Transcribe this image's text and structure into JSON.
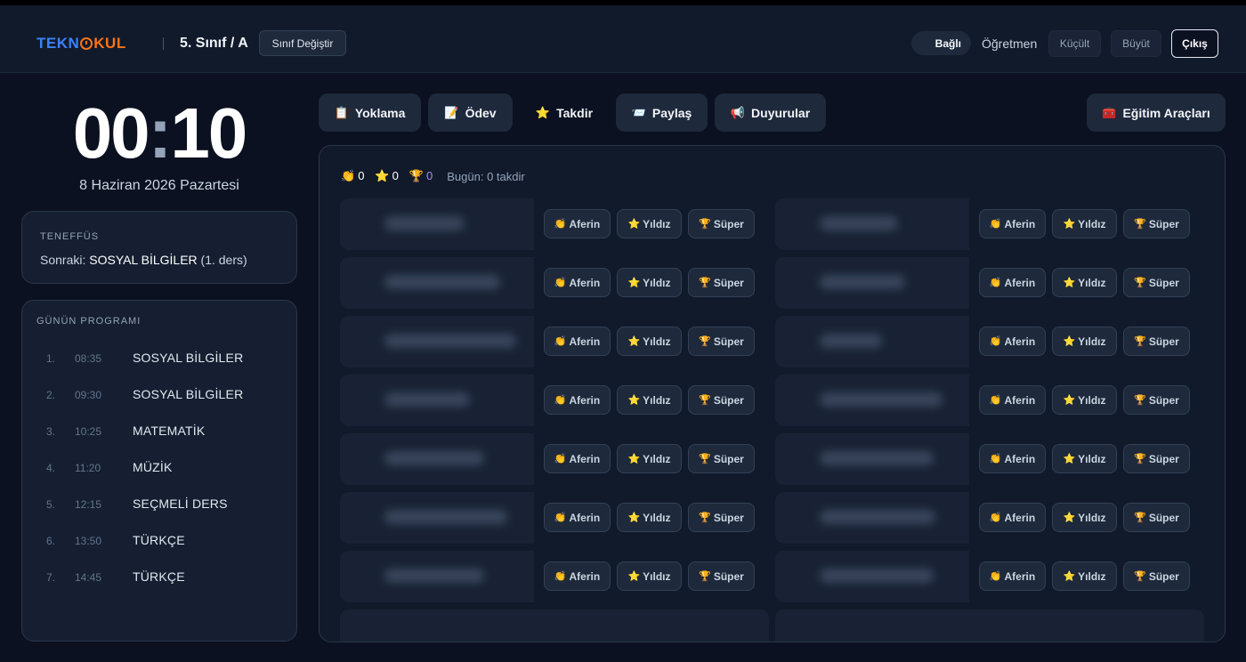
{
  "header": {
    "logo_left": "TEKN",
    "logo_right": "KUL",
    "class_name": "5. Sınıf / A",
    "change_class": "Sınıf Değiştir",
    "connection": "Bağlı",
    "role": "Öğretmen",
    "shrink": "Küçült",
    "grow": "Büyüt",
    "logout": "Çıkış"
  },
  "clock": {
    "hours": "00",
    "minutes": "10",
    "date": "8 Haziran 2026 Pazartesi"
  },
  "break_card": {
    "label": "TENEFFÜS",
    "next_prefix": "Sonraki:",
    "next_subject": "SOSYAL BİLGİLER",
    "next_suffix": "(1. ders)"
  },
  "schedule": {
    "title": "GÜNÜN PROGRAMI",
    "items": [
      {
        "num": "1.",
        "time": "08:35",
        "subject": "SOSYAL BİLGİLER"
      },
      {
        "num": "2.",
        "time": "09:30",
        "subject": "SOSYAL BİLGİLER"
      },
      {
        "num": "3.",
        "time": "10:25",
        "subject": "MATEMATİK"
      },
      {
        "num": "4.",
        "time": "11:20",
        "subject": "MÜZİK"
      },
      {
        "num": "5.",
        "time": "12:15",
        "subject": "SEÇMELİ DERS"
      },
      {
        "num": "6.",
        "time": "13:50",
        "subject": "TÜRKÇE"
      },
      {
        "num": "7.",
        "time": "14:45",
        "subject": "TÜRKÇE"
      }
    ]
  },
  "nav": {
    "attendance": {
      "icon": "📋",
      "label": "Yoklama"
    },
    "homework": {
      "icon": "📝",
      "label": "Ödev"
    },
    "praise": {
      "icon": "⭐",
      "label": "Takdir"
    },
    "share": {
      "icon": "📨",
      "label": "Paylaş"
    },
    "announcements": {
      "icon": "📢",
      "label": "Duyurular"
    },
    "tools": {
      "icon": "🧰",
      "label": "Eğitim Araçları"
    }
  },
  "stats": {
    "clap_icon": "👏",
    "clap": "0",
    "star_icon": "⭐",
    "star": "0",
    "trophy_icon": "🏆",
    "trophy": "0",
    "today": "Bugün: 0 takdir"
  },
  "praise_buttons": {
    "aferin_icon": "👏",
    "aferin": "Aferin",
    "yildiz_icon": "⭐",
    "yildiz": "Yıldız",
    "super_icon": "🏆",
    "super": "Süper"
  }
}
